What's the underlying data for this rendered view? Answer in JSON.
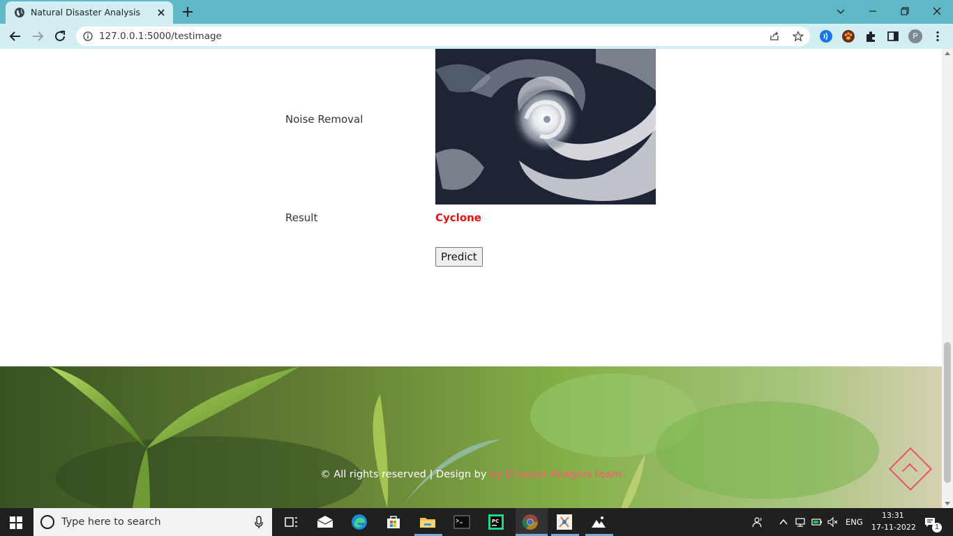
{
  "browser": {
    "tab_title": "Natural Disaster Analysis",
    "url": "127.0.0.1:5000/testimage",
    "profile_initial": "P"
  },
  "page": {
    "noise_removal_label": "Noise Removal",
    "result_label": "Result",
    "result_value": "Cyclone",
    "result_color": "#e81010",
    "predict_button": "Predict",
    "footer_text": "© All rights reserved | Design by ",
    "footer_link": "by Disaster Analysis team",
    "footer_link_color": "#ff5a6e"
  },
  "taskbar": {
    "search_placeholder": "Type here to search",
    "language": "ENG",
    "time": "13:31",
    "date": "17-11-2022",
    "notification_count": "1",
    "apps": [
      "windows-start-icon",
      "task-view-icon",
      "mail-icon",
      "edge-icon",
      "store-icon",
      "file-explorer-icon",
      "terminal-icon",
      "pycharm-icon",
      "chrome-icon",
      "paint-app-icon",
      "photos-icon"
    ]
  }
}
